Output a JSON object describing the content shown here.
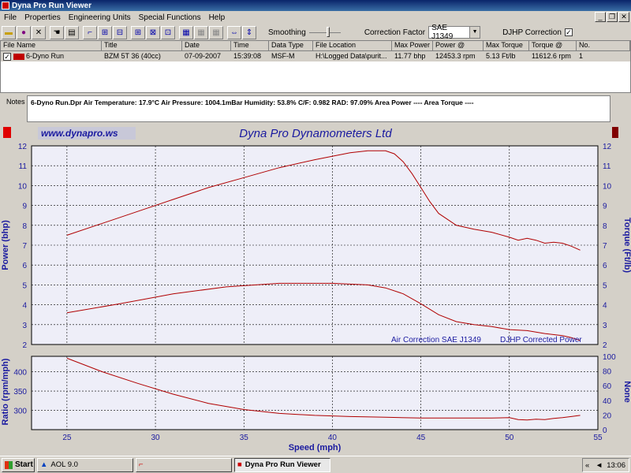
{
  "window": {
    "title": "Dyna Pro Run Viewer"
  },
  "menu": [
    "File",
    "Properties",
    "Engineering Units",
    "Special Functions",
    "Help"
  ],
  "toolbar": {
    "smoothing_label": "Smoothing",
    "smoothing_level": 0.6,
    "correction_factor_label": "Correction Factor",
    "correction_factor_value": "SAE J1349",
    "djhp_label": "DJHP Correction",
    "djhp_checked": true
  },
  "run_table": {
    "columns": [
      "File Name",
      "Title",
      "Date",
      "Time",
      "Data Type",
      "File Location",
      "Max Power",
      "Power @",
      "Max Torque",
      "Torque @",
      "No."
    ],
    "rows": [
      [
        "6-Dyno Run",
        "BZM 5T 36 (40cc)",
        "07-09-2007",
        "15:39:08",
        "MSF-M",
        "H:\\Logged Data\\purit...",
        "11.77 bhp",
        "12453.3 rpm",
        "5.13 Ft/lb",
        "11612.6 rpm",
        "1"
      ]
    ]
  },
  "notes": {
    "label": "Notes",
    "text": "6-Dyno Run.Dpr   Air Temperature: 17.9°C   Air Pressure: 1004.1mBar   Humidity: 53.8%   C/F: 0.982   RAD: 97.09%   Area Power ----   Area Torque ----"
  },
  "chart_header": {
    "website": "www.dynapro.ws",
    "company": "Dyna Pro Dynamometers Ltd"
  },
  "chart_data": [
    {
      "type": "line",
      "xlabel": "Speed (mph)",
      "ylabel": "Power (bhp)",
      "y2label": "Torque (Ft/lb)",
      "xlim": [
        23,
        55
      ],
      "ylim": [
        2,
        12
      ],
      "y2lim": [
        2,
        12
      ],
      "xticks": [
        25,
        30,
        35,
        40,
        45,
        50,
        55
      ],
      "yticks": [
        2,
        3,
        4,
        5,
        6,
        7,
        8,
        9,
        10,
        11,
        12
      ],
      "grid": true,
      "annotations": [
        "Air Correction SAE J1349",
        "DJHP Corrected Power"
      ],
      "series": [
        {
          "axis": "left",
          "color": "#b00000",
          "x": [
            25,
            27,
            29,
            31,
            33,
            35,
            37,
            39,
            41,
            42,
            43,
            43.5,
            44,
            44.5,
            45,
            45.5,
            46,
            47,
            48,
            49,
            50,
            50.5,
            51,
            51.5,
            52,
            52.5,
            53,
            53.5,
            54
          ],
          "y": [
            7.5,
            8.1,
            8.7,
            9.3,
            9.9,
            10.4,
            10.9,
            11.3,
            11.65,
            11.75,
            11.75,
            11.6,
            11.2,
            10.6,
            9.9,
            9.2,
            8.6,
            8.0,
            7.8,
            7.65,
            7.4,
            7.25,
            7.35,
            7.25,
            7.1,
            7.15,
            7.1,
            6.95,
            6.75
          ]
        },
        {
          "axis": "right",
          "color": "#b00000",
          "x": [
            25,
            28,
            31,
            34,
            37,
            40,
            42,
            43,
            44,
            45,
            46,
            47,
            48,
            49,
            50,
            51,
            52,
            53,
            53.5,
            54
          ],
          "y": [
            3.6,
            4.05,
            4.55,
            4.9,
            5.08,
            5.08,
            5.0,
            4.85,
            4.55,
            4.05,
            3.5,
            3.15,
            3.0,
            2.9,
            2.75,
            2.7,
            2.55,
            2.45,
            2.35,
            2.2
          ]
        }
      ]
    },
    {
      "type": "line",
      "xlabel": "Speed (mph)",
      "ylabel": "Ratio (rpm/mph)",
      "y2label": "None",
      "xlim": [
        23,
        55
      ],
      "ylim": [
        250,
        440
      ],
      "y2lim": [
        0,
        100
      ],
      "yticks": [
        300,
        350,
        400
      ],
      "y2ticks": [
        0,
        20,
        40,
        60,
        80,
        100
      ],
      "grid": true,
      "series": [
        {
          "axis": "left",
          "color": "#b00000",
          "x": [
            25,
            27,
            29,
            31,
            33,
            35,
            37,
            39,
            41,
            43,
            45,
            47,
            49,
            50,
            50.5,
            51,
            51.5,
            52,
            52.5,
            53,
            53.5,
            54
          ],
          "y": [
            435,
            400,
            370,
            342,
            318,
            302,
            292,
            287,
            284,
            282,
            280,
            280,
            280,
            281,
            276,
            275,
            277,
            276,
            279,
            281,
            284,
            287
          ]
        }
      ]
    }
  ],
  "taskbar": {
    "start": "Start",
    "tasks": [
      "AOL 9.0",
      "",
      "Dyna Pro Run Viewer"
    ],
    "clock": "13:06"
  }
}
